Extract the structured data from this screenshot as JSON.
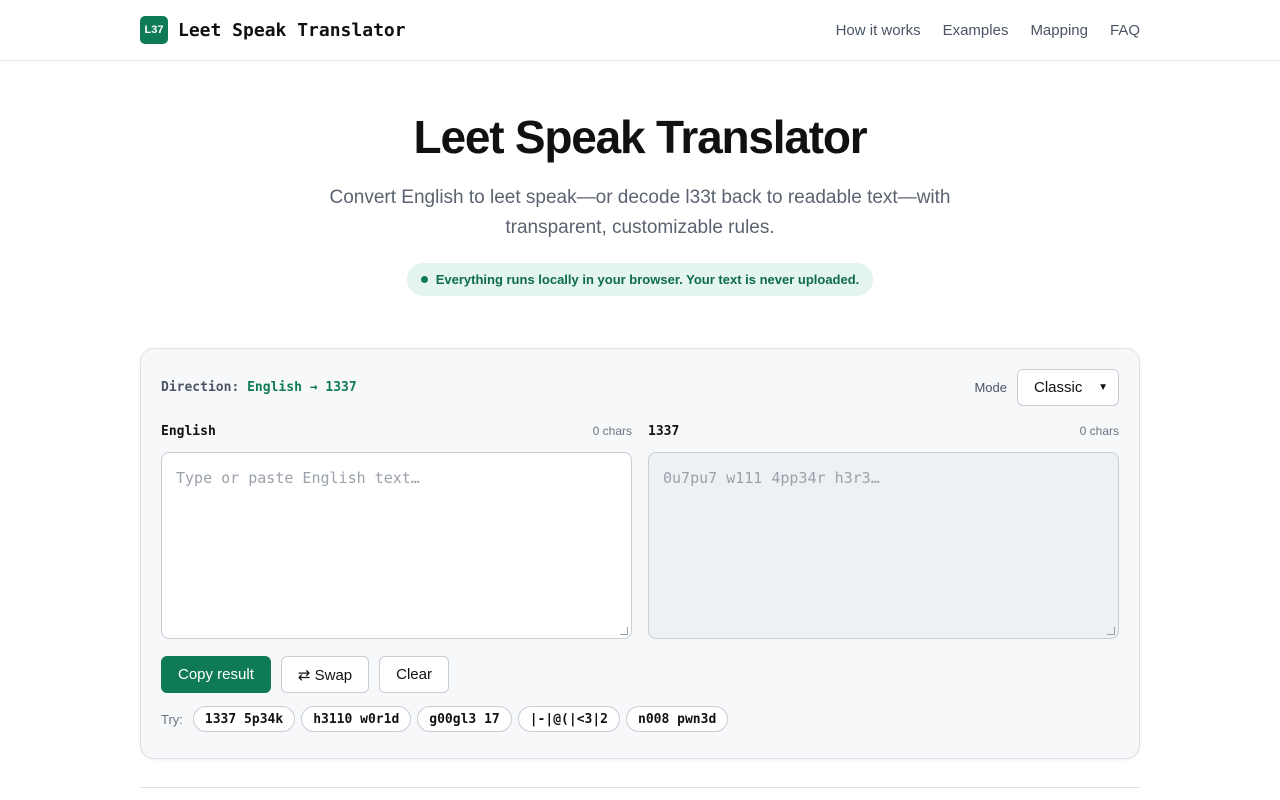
{
  "header": {
    "logo_text": "L37",
    "brand_name": "Leet Speak Translator",
    "nav": [
      "How it works",
      "Examples",
      "Mapping",
      "FAQ"
    ]
  },
  "hero": {
    "title": "Leet Speak Translator",
    "subtitle": "Convert English to leet speak—or decode l33t back to readable text—with transparent, customizable rules.",
    "notice": "Everything runs locally in your browser. Your text is never uploaded."
  },
  "translator": {
    "direction_label": "Direction:",
    "direction_value": "English → 1337",
    "mode_label": "Mode",
    "mode_value": "Classic",
    "input": {
      "title": "English",
      "count": "0 chars",
      "placeholder": "Type or paste English text…"
    },
    "output": {
      "title": "1337",
      "count": "0 chars",
      "placeholder": "0u7pu7 w111 4pp34r h3r3…"
    },
    "buttons": {
      "copy": "Copy result",
      "swap": "⇄ Swap",
      "clear": "Clear"
    },
    "try_label": "Try:",
    "examples": [
      "1337 5p34k",
      "h3110 w0r1d",
      "g00gl3 17",
      "|-|@(|<3|2",
      "n008 pwn3d"
    ]
  },
  "colors": {
    "accent": "#0f7a57",
    "notice_bg": "#e3f5ec"
  }
}
